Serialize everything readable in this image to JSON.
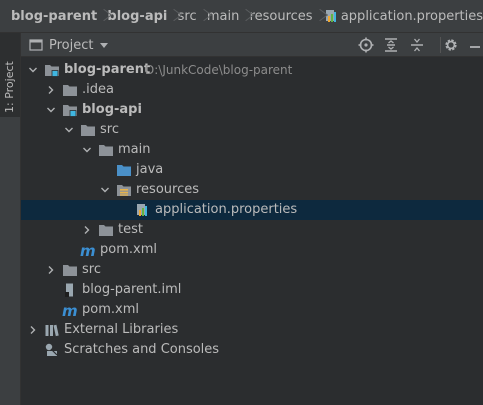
{
  "breadcrumb": {
    "items": [
      {
        "label": "blog-parent",
        "bold": true
      },
      {
        "label": "blog-api",
        "bold": true
      },
      {
        "label": "src",
        "bold": false
      },
      {
        "label": "main",
        "bold": false
      },
      {
        "label": "resources",
        "bold": false
      },
      {
        "label": "application.properties",
        "bold": false,
        "icon": "properties-file-icon"
      }
    ]
  },
  "side_strip": {
    "tab_label": "1: Project"
  },
  "panel": {
    "title": "Project",
    "toolbar": [
      "locate-icon",
      "expand-all-icon",
      "collapse-all-icon",
      "gear-icon",
      "hide-icon"
    ]
  },
  "tree": {
    "rows": [
      {
        "label": "blog-parent",
        "path": "D:\\JunkCode\\blog-parent",
        "bold": true,
        "icon": "module-folder-icon",
        "expanded": true,
        "depth": 0
      },
      {
        "label": ".idea",
        "icon": "folder-icon",
        "expanded": false,
        "depth": 1
      },
      {
        "label": "blog-api",
        "bold": true,
        "icon": "module-folder-icon",
        "expanded": true,
        "depth": 1
      },
      {
        "label": "src",
        "icon": "folder-icon",
        "expanded": true,
        "depth": 2
      },
      {
        "label": "main",
        "icon": "folder-icon",
        "expanded": true,
        "depth": 3
      },
      {
        "label": "java",
        "icon": "source-folder-icon",
        "depth": 4
      },
      {
        "label": "resources",
        "icon": "resources-folder-icon",
        "expanded": true,
        "depth": 4
      },
      {
        "label": "application.properties",
        "icon": "properties-file-icon",
        "depth": 5,
        "selected": true
      },
      {
        "label": "test",
        "icon": "folder-icon",
        "expanded": false,
        "depth": 3
      },
      {
        "label": "pom.xml",
        "icon": "maven-icon",
        "depth": 2
      },
      {
        "label": "src",
        "icon": "folder-icon",
        "expanded": false,
        "depth": 1
      },
      {
        "label": "blog-parent.iml",
        "icon": "iml-file-icon",
        "depth": 1
      },
      {
        "label": "pom.xml",
        "icon": "maven-icon",
        "depth": 1
      },
      {
        "label": "External Libraries",
        "icon": "libraries-icon",
        "expanded": false,
        "depth": 0
      },
      {
        "label": "Scratches and Consoles",
        "icon": "scratches-icon",
        "depth": 0
      }
    ]
  },
  "colors": {
    "background": "#2b2d2f",
    "toolbar": "#3c3f41",
    "selection": "#0d293e",
    "text": "#bbbbbb",
    "folder": "#8d9298",
    "source_folder": "#4a90c8",
    "maven": "#3b8fd3"
  }
}
